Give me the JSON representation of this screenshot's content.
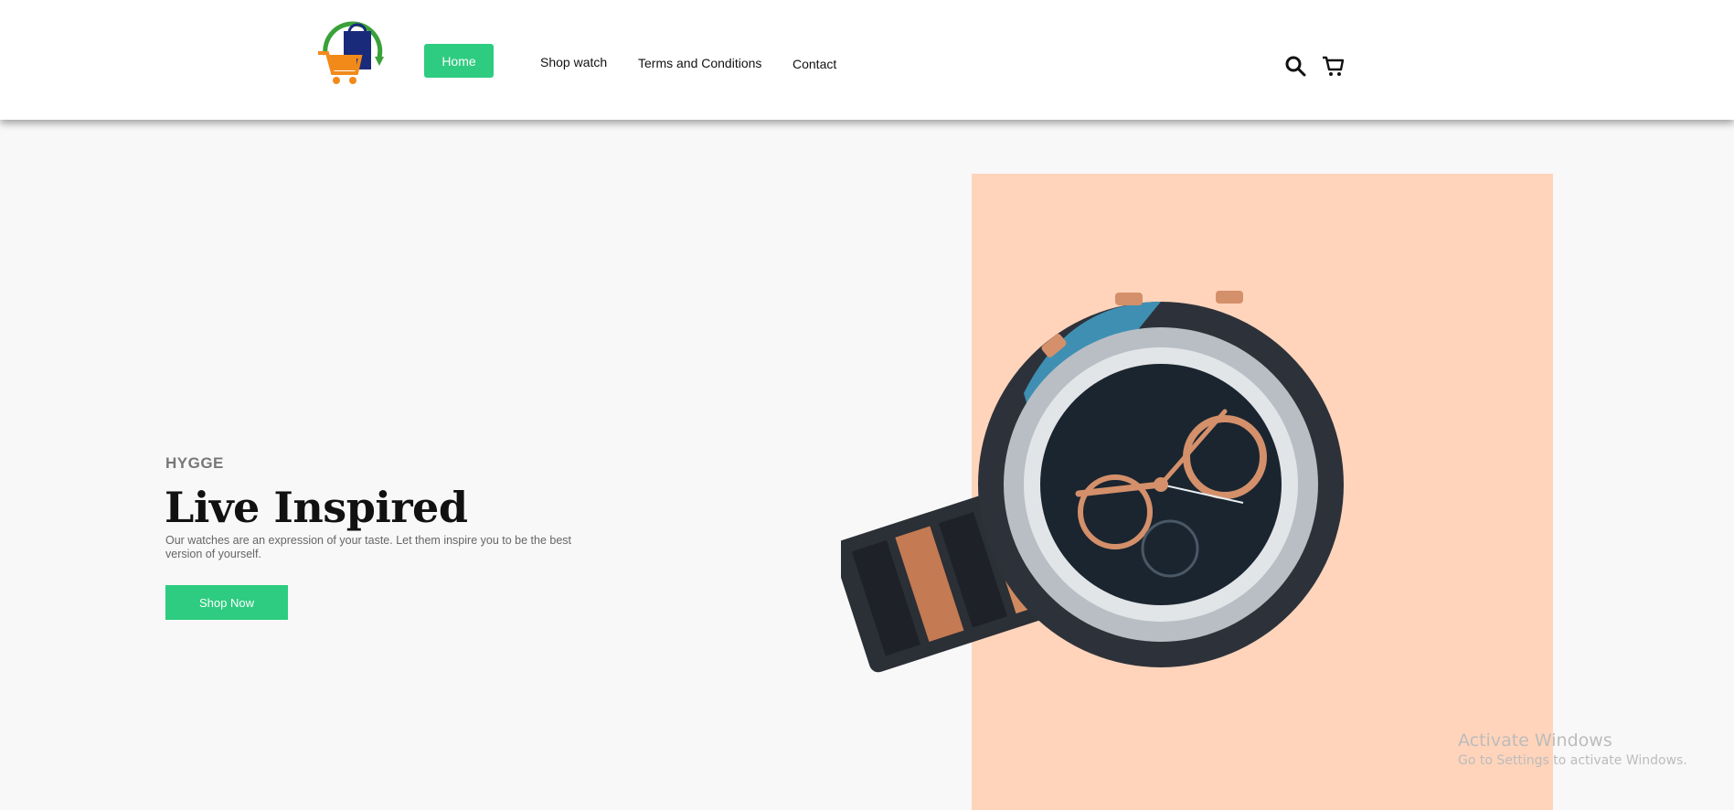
{
  "header": {
    "nav": {
      "home": "Home",
      "shop_watch": "Shop watch",
      "terms": "Terms and Conditions",
      "contact": "Contact"
    },
    "icons": [
      "search-icon",
      "cart-icon"
    ]
  },
  "hero": {
    "eyebrow": "HYGGE",
    "title": "Live Inspired",
    "subtitle": "Our watches are an expression of your taste. Let them inspire you to be the best version of yourself.",
    "cta": "Shop Now"
  },
  "watermark": {
    "title": "Activate Windows",
    "subtitle": "Go to Settings to activate Windows."
  },
  "colors": {
    "accent": "#2ecc80",
    "peach": "#ffd4bb",
    "background": "#f8f8f8"
  }
}
